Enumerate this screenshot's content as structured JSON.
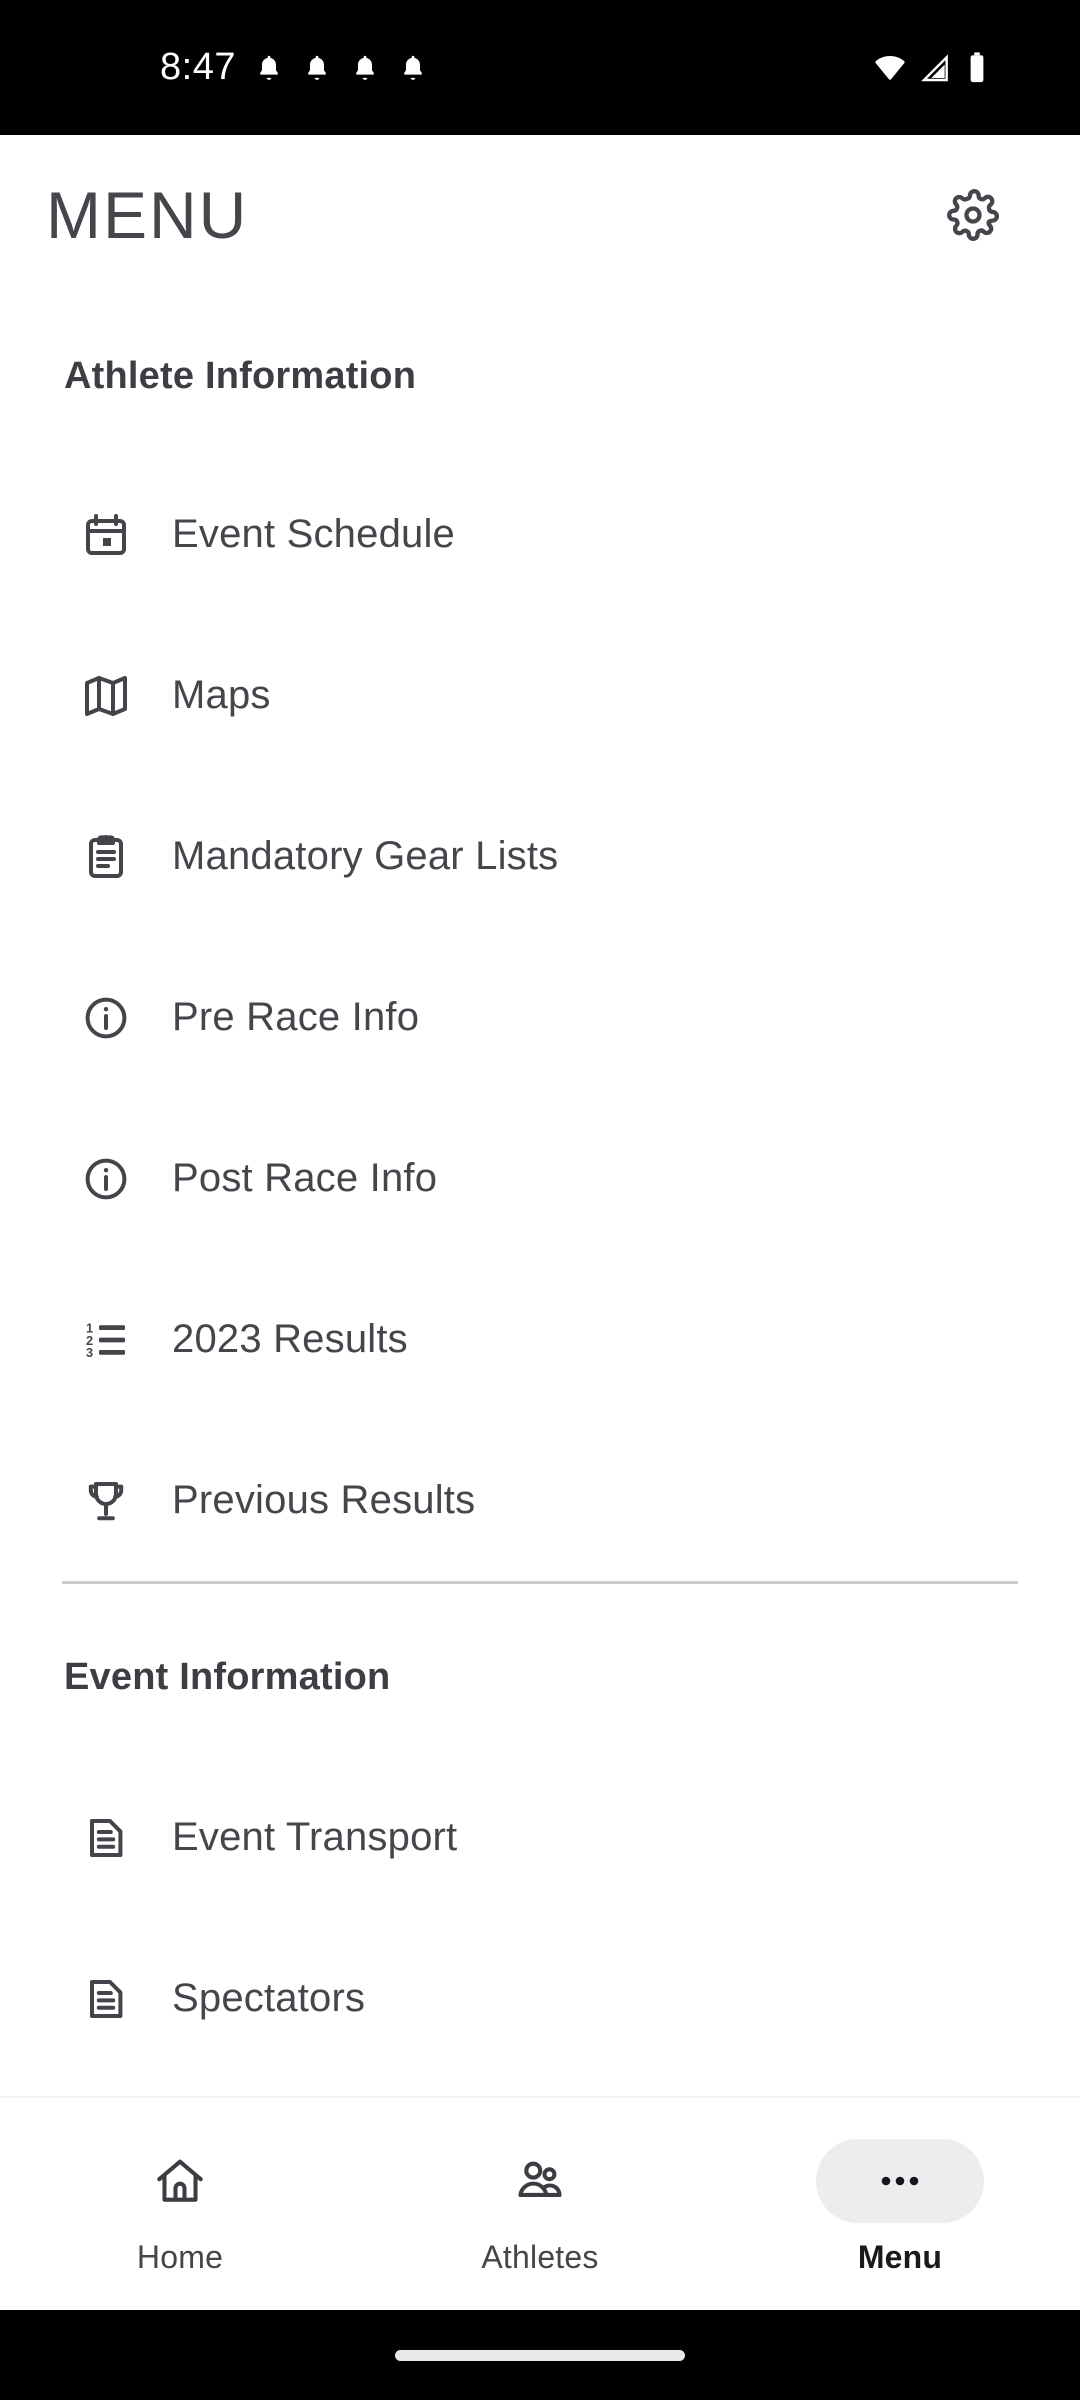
{
  "status_bar": {
    "time": "8:47",
    "notification_icons": [
      "bell-icon",
      "bell-icon",
      "bell-icon",
      "bell-icon"
    ],
    "right_icons": [
      "wifi-icon",
      "cellular-signal-icon",
      "battery-icon"
    ],
    "background_color": "#000000"
  },
  "header": {
    "title": "MENU",
    "settings_icon": "gear-icon"
  },
  "sections": [
    {
      "title": "Athlete Information",
      "items": [
        {
          "label": "Event Schedule",
          "icon": "calendar-icon"
        },
        {
          "label": "Maps",
          "icon": "map-icon"
        },
        {
          "label": "Mandatory Gear Lists",
          "icon": "clipboard-list-icon"
        },
        {
          "label": "Pre Race Info",
          "icon": "info-circle-icon"
        },
        {
          "label": "Post Race Info",
          "icon": "info-circle-icon"
        },
        {
          "label": "2023 Results",
          "icon": "numbered-list-icon"
        },
        {
          "label": "Previous Results",
          "icon": "trophy-icon"
        }
      ]
    },
    {
      "title": "Event Information",
      "items": [
        {
          "label": "Event Transport",
          "icon": "document-icon"
        },
        {
          "label": "Spectators",
          "icon": "document-icon"
        }
      ]
    }
  ],
  "bottom_nav": {
    "tabs": [
      {
        "label": "Home",
        "icon": "home-icon",
        "active": false
      },
      {
        "label": "Athletes",
        "icon": "people-icon",
        "active": false
      },
      {
        "label": "Menu",
        "icon": "ellipsis-icon",
        "active": true
      }
    ],
    "active_pill_color": "#ECEDEF"
  },
  "colors": {
    "text_primary": "#45464B",
    "divider": "#CBCBCE",
    "background": "#FFFFFF",
    "system_bar": "#000000"
  }
}
